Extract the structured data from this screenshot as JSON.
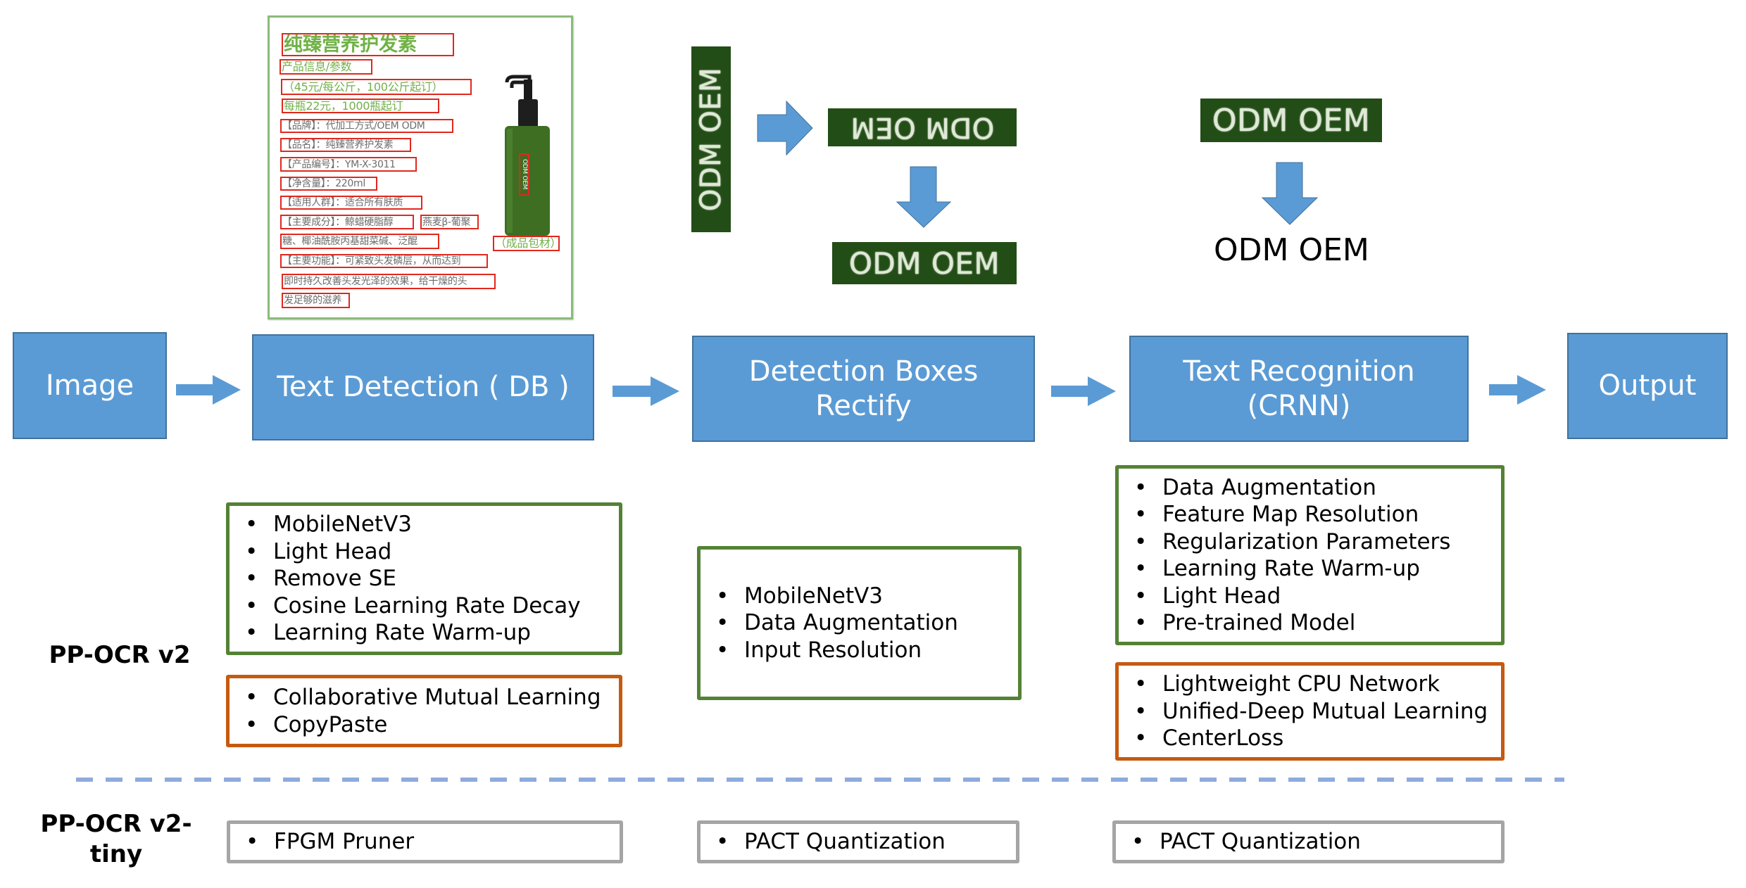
{
  "product_image": {
    "title": "纯臻营养护发素",
    "lines": [
      {
        "text": "产品信息/参数",
        "style": "green"
      },
      {
        "text": "（45元/每公斤，100公斤起订）",
        "style": "green"
      },
      {
        "text": "每瓶22元，1000瓶起订",
        "style": "green"
      },
      {
        "text": "【品牌】：代加工方式/OEM ODM",
        "style": "gray"
      },
      {
        "text": "【品名】：纯臻营养护发素",
        "style": "gray"
      },
      {
        "text": "【产品编号】：YM-X-3011",
        "style": "gray"
      },
      {
        "text": "【净含量】：220ml",
        "style": "gray"
      },
      {
        "text": "【适用人群】：适合所有肤质",
        "style": "gray"
      },
      {
        "text": "【主要成分】：鲸蜡硬脂醇",
        "style": "gray"
      },
      {
        "text": "燕麦β-葡聚",
        "style": "gray"
      },
      {
        "text": "糖、椰油酰胺丙基甜菜碱、泛醌",
        "style": "gray"
      },
      {
        "text": "【主要功能】：可紧致头发磷层，从而达到",
        "style": "gray"
      },
      {
        "text": "即时持久改善头发光泽的效果，给干燥的头",
        "style": "gray"
      },
      {
        "text": "发足够的滋养",
        "style": "gray"
      }
    ],
    "bottle_label": "ODM OEM",
    "caption": "（成品包材）"
  },
  "crops": {
    "vertical": "ODM OEM",
    "flipped": "ODM OEM",
    "rectified": "ODM OEM",
    "recognition_input": "ODM OEM"
  },
  "recognition_result": "ODM OEM",
  "pipeline": {
    "stages": [
      {
        "id": "image",
        "label": "Image"
      },
      {
        "id": "text-detection",
        "label": "Text Detection ( DB )"
      },
      {
        "id": "detection-boxes-rectify",
        "label": "Detection Boxes\nRectify"
      },
      {
        "id": "text-recognition",
        "label": "Text Recognition\n(CRNN)"
      },
      {
        "id": "output",
        "label": "Output"
      }
    ]
  },
  "versions": {
    "v2_label": "PP-OCR v2",
    "v2_tiny_label": "PP-OCR v2-\ntiny"
  },
  "features": {
    "detection_green": [
      "MobileNetV3",
      "Light Head",
      "Remove SE",
      "Cosine Learning Rate Decay",
      "Learning Rate Warm-up"
    ],
    "detection_orange": [
      "Collaborative Mutual Learning",
      "CopyPaste"
    ],
    "rectify_green": [
      "MobileNetV3",
      "Data Augmentation",
      "Input Resolution"
    ],
    "recognition_green": [
      "Data Augmentation",
      "Feature Map Resolution",
      "Regularization Parameters",
      "Learning Rate Warm-up",
      "Light Head",
      "Pre-trained Model"
    ],
    "recognition_orange": [
      "Lightweight CPU Network",
      "Unified-Deep Mutual Learning",
      "CenterLoss"
    ],
    "tiny_detection": [
      "FPGM Pruner"
    ],
    "tiny_rectify": [
      "PACT Quantization"
    ],
    "tiny_recognition": [
      "PACT Quantization"
    ]
  },
  "colors": {
    "stage_fill": "#5b9bd5",
    "stage_border": "#41719c",
    "v2_box_border": "#548235",
    "new_feature_border": "#c55a11",
    "tiny_box_border": "#a5a5a5",
    "separator": "#8faadc",
    "crop_background": "#234d16"
  },
  "bullet": "•"
}
